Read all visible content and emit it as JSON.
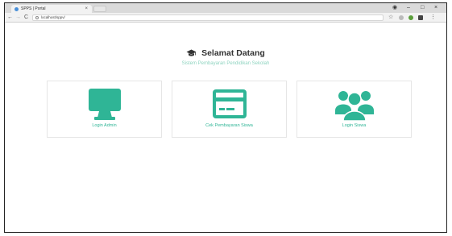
{
  "browser": {
    "tab_title": "SPPS | Portal",
    "tab_close": "×",
    "minimize": "–",
    "maximize": "□",
    "close": "×",
    "back": "←",
    "forward": "→",
    "reload": "C",
    "url": "localhost/sppv/",
    "bookmark": "☆"
  },
  "page": {
    "title": "Selamat Datang",
    "subtitle": "Sistem Pembayaran Pendidikan Sekolah"
  },
  "cards": [
    {
      "label": "Login Admin",
      "icon": "monitor-icon"
    },
    {
      "label": "Cek Pembayaran Siswa",
      "icon": "credit-card-icon"
    },
    {
      "label": "Login Siswa",
      "icon": "users-icon"
    }
  ],
  "colors": {
    "accent": "#2fb596",
    "subtitle": "#8fd4c0",
    "title": "#333333"
  }
}
